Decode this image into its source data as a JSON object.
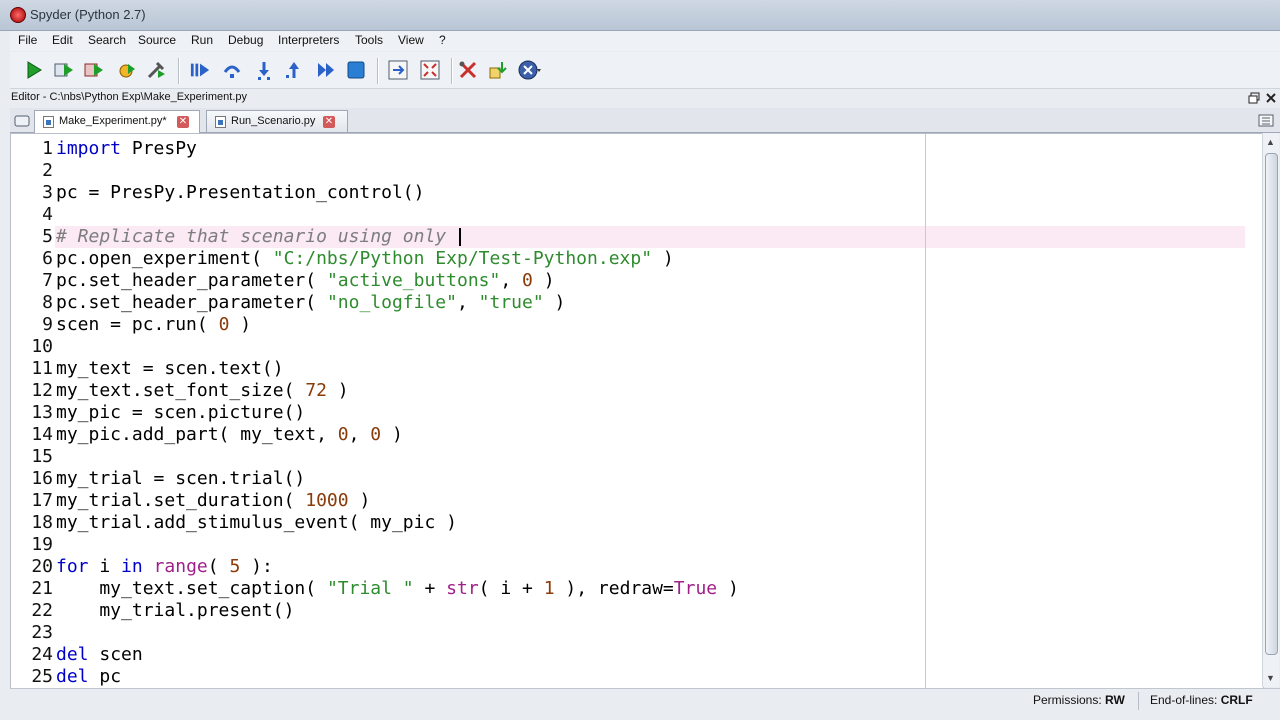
{
  "window": {
    "title": "Spyder (Python 2.7)"
  },
  "menu": [
    "File",
    "Edit",
    "Search",
    "Source",
    "Run",
    "Debug",
    "Interpreters",
    "Tools",
    "View",
    "?"
  ],
  "toolbar_icons": [
    "run-icon",
    "run-selection-icon",
    "run-config-icon",
    "debug-icon",
    "configure-icon",
    "debug-continue-icon",
    "step-over-icon",
    "step-into-icon",
    "step-return-icon",
    "continue-icon",
    "stop-icon",
    "indent-icon",
    "fullscreen-icon",
    "tools-icon",
    "python-path-icon",
    "close-all-icon"
  ],
  "editor": {
    "path": "Editor - C:\\nbs\\Python Exp\\Make_Experiment.py",
    "tabs": [
      {
        "label": "Make_Experiment.py*",
        "active": true
      },
      {
        "label": "Run_Scenario.py",
        "active": false
      }
    ]
  },
  "code": [
    {
      "n": "1",
      "t": "import PresPy"
    },
    {
      "n": "2",
      "t": ""
    },
    {
      "n": "3",
      "t": "pc = PresPy.Presentation_control()"
    },
    {
      "n": "4",
      "t": ""
    },
    {
      "n": "5",
      "t": "# Replicate that scenario using only "
    },
    {
      "n": "6",
      "t": "pc.open_experiment( \"C:/nbs/Python Exp/Test-Python.exp\" )"
    },
    {
      "n": "7",
      "t": "pc.set_header_parameter( \"active_buttons\", 0 )"
    },
    {
      "n": "8",
      "t": "pc.set_header_parameter( \"no_logfile\", \"true\" )"
    },
    {
      "n": "9",
      "t": "scen = pc.run( 0 )"
    },
    {
      "n": "10",
      "t": ""
    },
    {
      "n": "11",
      "t": "my_text = scen.text()"
    },
    {
      "n": "12",
      "t": "my_text.set_font_size( 72 )"
    },
    {
      "n": "13",
      "t": "my_pic = scen.picture()"
    },
    {
      "n": "14",
      "t": "my_pic.add_part( my_text, 0, 0 )"
    },
    {
      "n": "15",
      "t": ""
    },
    {
      "n": "16",
      "t": "my_trial = scen.trial()"
    },
    {
      "n": "17",
      "t": "my_trial.set_duration( 1000 )"
    },
    {
      "n": "18",
      "t": "my_trial.add_stimulus_event( my_pic )"
    },
    {
      "n": "19",
      "t": ""
    },
    {
      "n": "20",
      "t": "for i in range( 5 ):"
    },
    {
      "n": "21",
      "t": "    my_text.set_caption( \"Trial \" + str( i + 1 ), redraw=True )"
    },
    {
      "n": "22",
      "t": "    my_trial.present()"
    },
    {
      "n": "23",
      "t": ""
    },
    {
      "n": "24",
      "t": "del scen"
    },
    {
      "n": "25",
      "t": "del pc"
    }
  ],
  "status": {
    "permissions_label": "Permissions:",
    "permissions_value": "RW",
    "eol_label": "End-of-lines:",
    "eol_value": "CRLF"
  },
  "colors": {
    "keyword": "#0000c8",
    "string": "#2e8b2e",
    "number": "#8b3a0a",
    "comment": "#7d7d7d",
    "builtin": "#a0208a",
    "current_line": "#fbe9f3"
  }
}
